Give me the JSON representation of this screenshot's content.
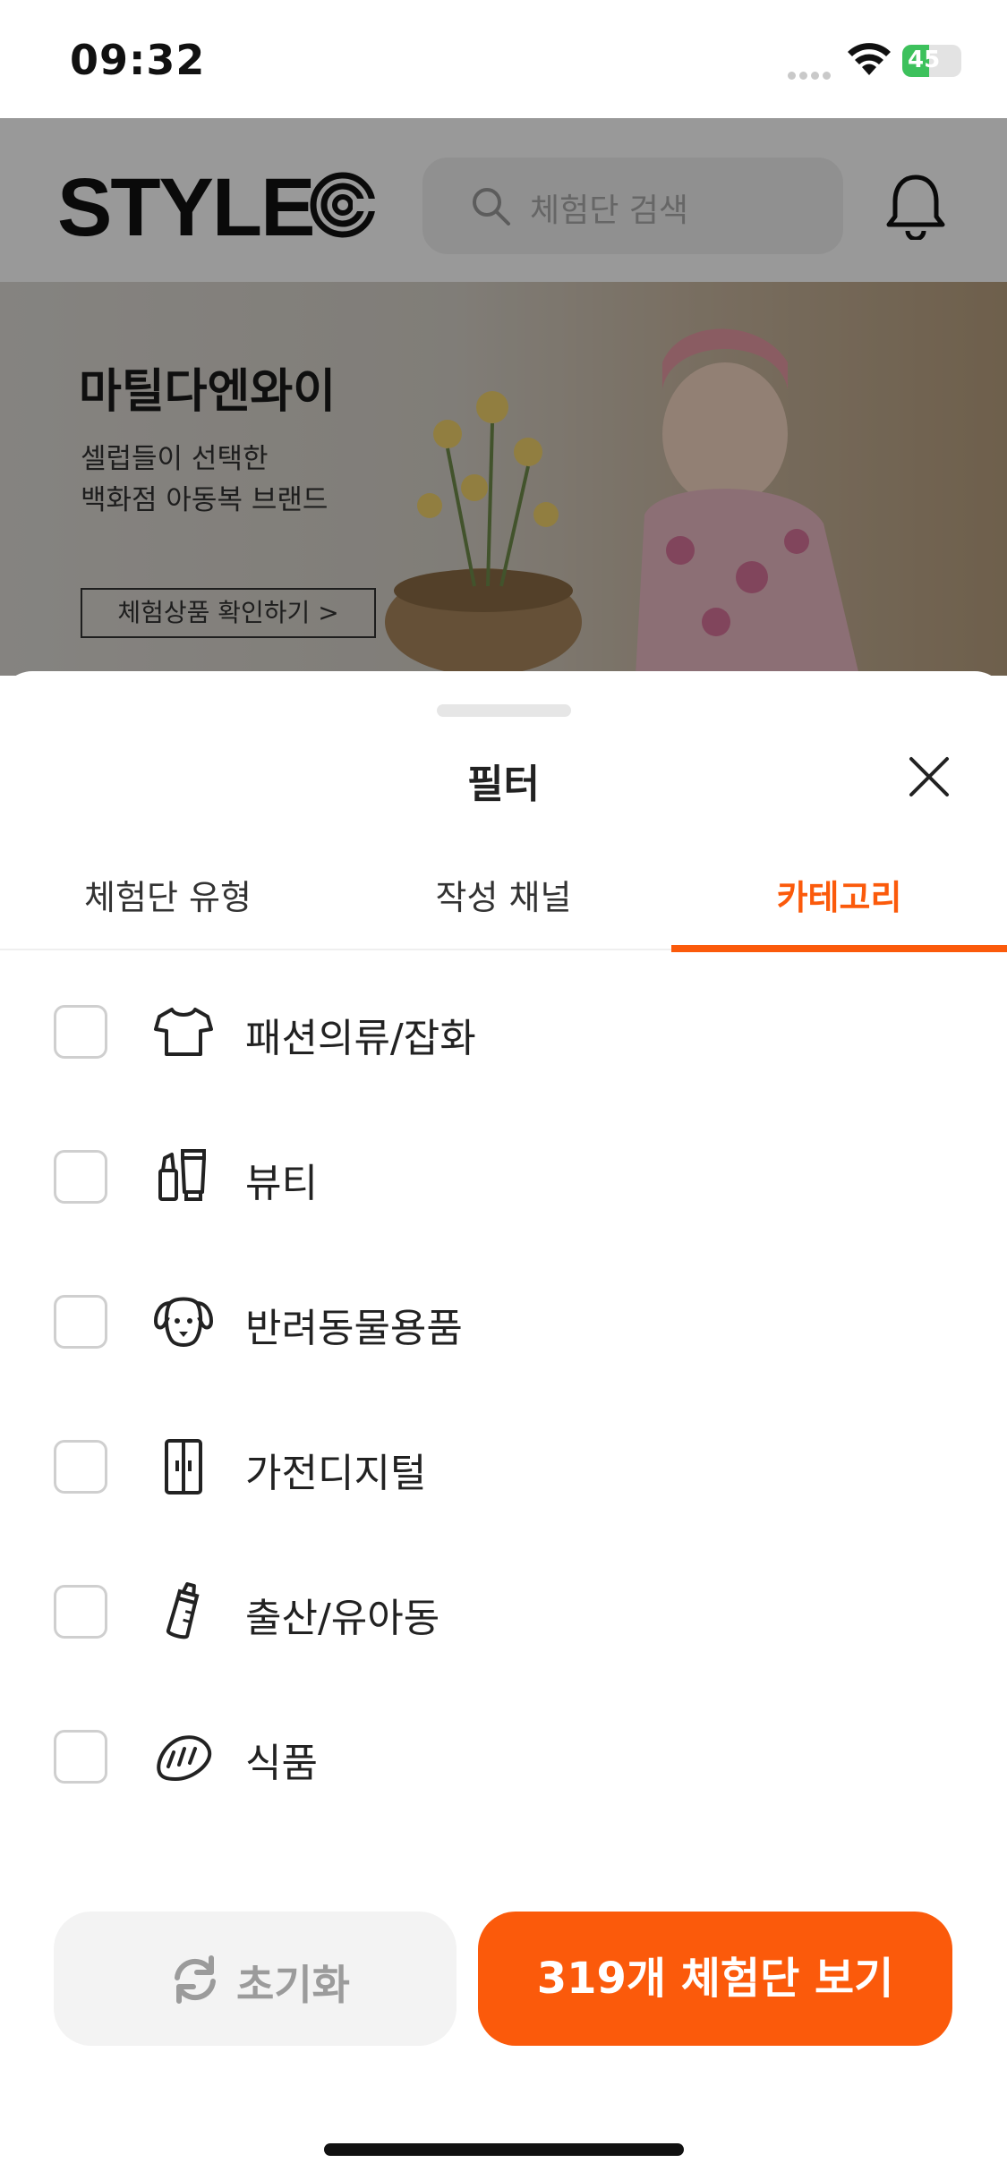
{
  "status_bar": {
    "time": "09:32",
    "battery": "45",
    "battery_level": 0.45
  },
  "header": {
    "logo": "STYLE",
    "search_placeholder": "체험단 검색"
  },
  "banner": {
    "title": "마틸다엔와이",
    "subtitle_line1": "셀럽들이 선택한",
    "subtitle_line2": "백화점 아동복 브랜드",
    "cta": "체험상품 확인하기 >"
  },
  "sheet": {
    "title": "필터",
    "tabs": [
      {
        "label": "체험단 유형",
        "active": false
      },
      {
        "label": "작성 채널",
        "active": false
      },
      {
        "label": "카테고리",
        "active": true
      }
    ],
    "categories": [
      {
        "label": "패션의류/잡화",
        "icon": "tshirt-icon",
        "checked": false
      },
      {
        "label": "뷰티",
        "icon": "cosmetics-icon",
        "checked": false
      },
      {
        "label": "반려동물용품",
        "icon": "dog-icon",
        "checked": false
      },
      {
        "label": "가전디지털",
        "icon": "refrigerator-icon",
        "checked": false
      },
      {
        "label": "출산/유아동",
        "icon": "baby-bottle-icon",
        "checked": false
      },
      {
        "label": "식품",
        "icon": "bread-icon",
        "checked": false
      }
    ],
    "reset_label": "초기화",
    "apply_label": "319개 체험단 보기"
  },
  "colors": {
    "accent": "#fb5a0b",
    "battery_green": "#3dc15c"
  }
}
